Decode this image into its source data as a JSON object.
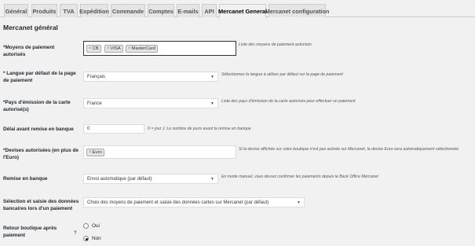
{
  "tabs": [
    {
      "label": "Général",
      "active": false
    },
    {
      "label": "Produits",
      "active": false
    },
    {
      "label": "TVA",
      "active": false
    },
    {
      "label": "Expédition",
      "active": false
    },
    {
      "label": "Commande",
      "active": false
    },
    {
      "label": "Comptes",
      "active": false
    },
    {
      "label": "E-mails",
      "active": false
    },
    {
      "label": "API",
      "active": false
    },
    {
      "label": "Mercanet General",
      "active": true
    },
    {
      "label": "Mercanet configuration",
      "active": false
    }
  ],
  "section_title": "Mercanet général",
  "payment_methods": {
    "label_line1": "*Moyens de paiement",
    "label_line2": "autorisés",
    "chips": [
      "CB",
      "VISA",
      "MasterCard"
    ],
    "chip_remove_glyph": "×",
    "description": "Liste des moyens de paiement autorisés"
  },
  "language": {
    "label_line1": "* Langue par défaut de la page",
    "label_line2": "de paiement",
    "value": "Français",
    "description": "Sélectionnez la langue à utiliser par défaut sur la page de paiement"
  },
  "issuing_country": {
    "label_line1": "*Pays d'émission de la carte",
    "label_line2": "autorisé(s)",
    "value": "France",
    "description": "Liste des pays d'émission de la carte autorisés pour effectuer un paiement"
  },
  "delay": {
    "label": "Délai avant remise en banque",
    "value": "0",
    "description": "0 = jour J. Le nombre de jours avant la remise en banque"
  },
  "currencies": {
    "label_line1": "*Devises autorisées (en plus de",
    "label_line2": "l'Euro)",
    "chips": [
      "Euro"
    ],
    "description_line1": "Si la devise affichée sur votre boutique n'est pas activée sur Mercanet, la devise Euro sera automatiquement sélectionnée"
  },
  "bank_remittance": {
    "label": "Remise en banque",
    "value": "Envoi automatique (par défaut)",
    "description": "En mode manuel, vous devrez confirmer les paiements depuis le Back Office Mercanet"
  },
  "card_entry": {
    "label_line1": "Sélection et saisie des données",
    "label_line2": "bancaires lors d'un paiement",
    "value": "Choix des moyens de paiement et saisie des données cartes sur Mercanet (par défaut)"
  },
  "return_shop": {
    "label_line1": "Retour boutique après",
    "label_line2": "paiement",
    "help_glyph": "?",
    "options": [
      {
        "label": "Oui",
        "checked": false
      },
      {
        "label": "Non",
        "checked": true
      }
    ]
  },
  "icons": {
    "chevron": "chevron-down-icon",
    "remove": "close-icon",
    "help": "question-icon"
  }
}
